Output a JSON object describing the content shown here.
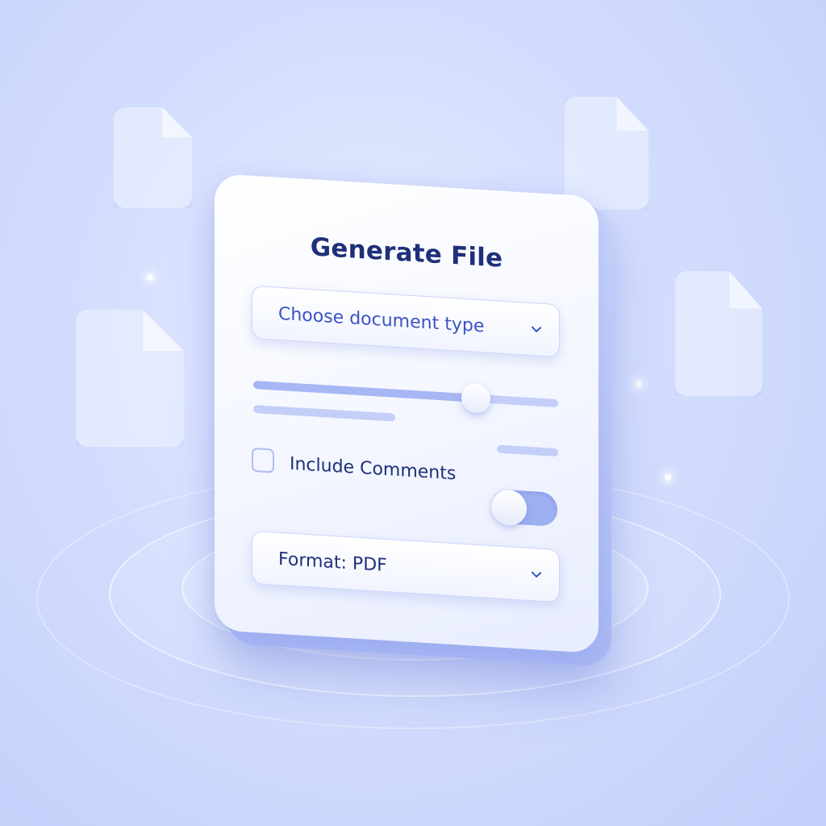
{
  "dialog": {
    "title": "Generate File",
    "document_type_select": {
      "value": "Choose document type",
      "icon": "chevron-down-icon"
    },
    "slider": {
      "value_fraction": 0.73
    },
    "include_comments": {
      "label": "Include Comments",
      "checked": false
    },
    "toggle": {
      "on": false
    },
    "format_select": {
      "value": "Format: PDF",
      "icon": "chevron-down-icon"
    }
  },
  "background": {
    "decorative_icons": [
      "document-icon",
      "document-icon",
      "document-icon",
      "document-icon"
    ]
  },
  "colors": {
    "accent": "#3a52c2",
    "title": "#1f2f7a",
    "track": "#c4cff9",
    "toggle_track": "#9db0f2",
    "background": "#d3ddfd"
  }
}
